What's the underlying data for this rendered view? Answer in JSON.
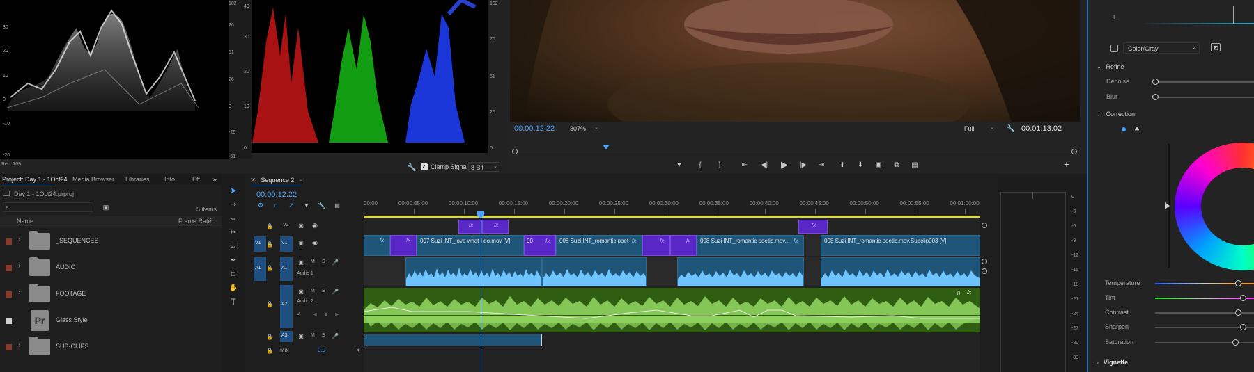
{
  "scopes": {
    "waveform_ticks_left": [
      "30",
      "20",
      "10",
      "0",
      "-10",
      "-20"
    ],
    "waveform_ticks_right": [
      "102",
      "76",
      "51",
      "26",
      "0",
      "-26",
      "-51"
    ],
    "rgb_ticks_left": [
      "40",
      "30",
      "20",
      "10",
      "0"
    ],
    "rgb_ticks_right": [
      "102",
      "76",
      "51",
      "26",
      "0"
    ],
    "rec_label": "Rec. 709",
    "clamp_signal_label": "Clamp Signal",
    "bit_depth": "8 Bit"
  },
  "program_monitor": {
    "timecode": "00:00:12:22",
    "zoom": "307%",
    "quality": "Full",
    "duration": "00:01:13:02",
    "playhead_fraction": 0.164
  },
  "project_panel": {
    "tabs": [
      "Project: Day 1 - 1Oct24",
      "Media Browser",
      "Libraries",
      "Info",
      "Eff"
    ],
    "more_icon": "chevron-double-right",
    "project_file": "Day 1 - 1Oct24.prproj",
    "items_count": "5 items",
    "search_placeholder": "",
    "col_name": "Name",
    "col_framerate": "Frame Rate",
    "items": [
      {
        "name": "_SEQUENCES",
        "type": "folder",
        "color": "#8a3a2a"
      },
      {
        "name": "AUDIO",
        "type": "folder",
        "color": "#8a3a2a"
      },
      {
        "name": "FOOTAGE",
        "type": "folder",
        "color": "#8a3a2a"
      },
      {
        "name": "Glass Style",
        "type": "premiere-file",
        "color": "#d0d0d0"
      },
      {
        "name": "SUB-CLIPS",
        "type": "folder",
        "color": "#8a3a2a"
      }
    ],
    "pr_label": "Pr"
  },
  "timeline": {
    "sequence_name": "Sequence 2",
    "timecode": "00:00:12:22",
    "ruler_labels": [
      "00:00",
      "00:00:05:00",
      "00:00:10:00",
      "00:00:15:00",
      "00:00:20:00",
      "00:00:25:00",
      "00:00:30:00",
      "00:00:35:00",
      "00:00:40:00",
      "00:00:45:00",
      "00:00:50:00",
      "00:00:55:00",
      "00:01:00:00"
    ],
    "tracks": {
      "v2": "V2",
      "v1": "V1",
      "a1": "A1",
      "a2": "A2",
      "a3": "A3",
      "v1_src": "V1",
      "a1_src": "A1",
      "audio1_name": "Audio 1",
      "audio2_name": "Audio 2",
      "mix_label": "Mix",
      "mix_value": "0.0",
      "m": "M",
      "s": "S",
      "volume_value": "0."
    },
    "clips": [
      "007 Suzi INT_love what I do.mov [V]",
      "00",
      "008 Suzi INT_romantic poet...",
      "008 Suzi INT_romantic poetic.mov...",
      "008 Suzi INT_romantic poetic.mov.Subclip003 [V]"
    ],
    "fx": "fx"
  },
  "meter": {
    "ticks": [
      "0",
      "-3",
      "-6",
      "-9",
      "-12",
      "-15",
      "-18",
      "-21",
      "-24",
      "-27",
      "-30",
      "-33"
    ]
  },
  "lumetri": {
    "l_label": "L",
    "color_gray_label": "Color/Gray",
    "refine_label": "Refine",
    "denoise_label": "Denoise",
    "blur_label": "Blur",
    "correction_label": "Correction",
    "temperature_label": "Temperature",
    "tint_label": "Tint",
    "contrast_label": "Contrast",
    "sharpen_label": "Sharpen",
    "saturation_label": "Saturation",
    "vignette_label": "Vignette",
    "slider_levels": {
      "denoise": 0.0,
      "blur": 0.0,
      "temperature": 0.85,
      "tint": 0.9,
      "contrast": 0.85,
      "sharpen": 0.9,
      "saturation": 0.82
    }
  }
}
